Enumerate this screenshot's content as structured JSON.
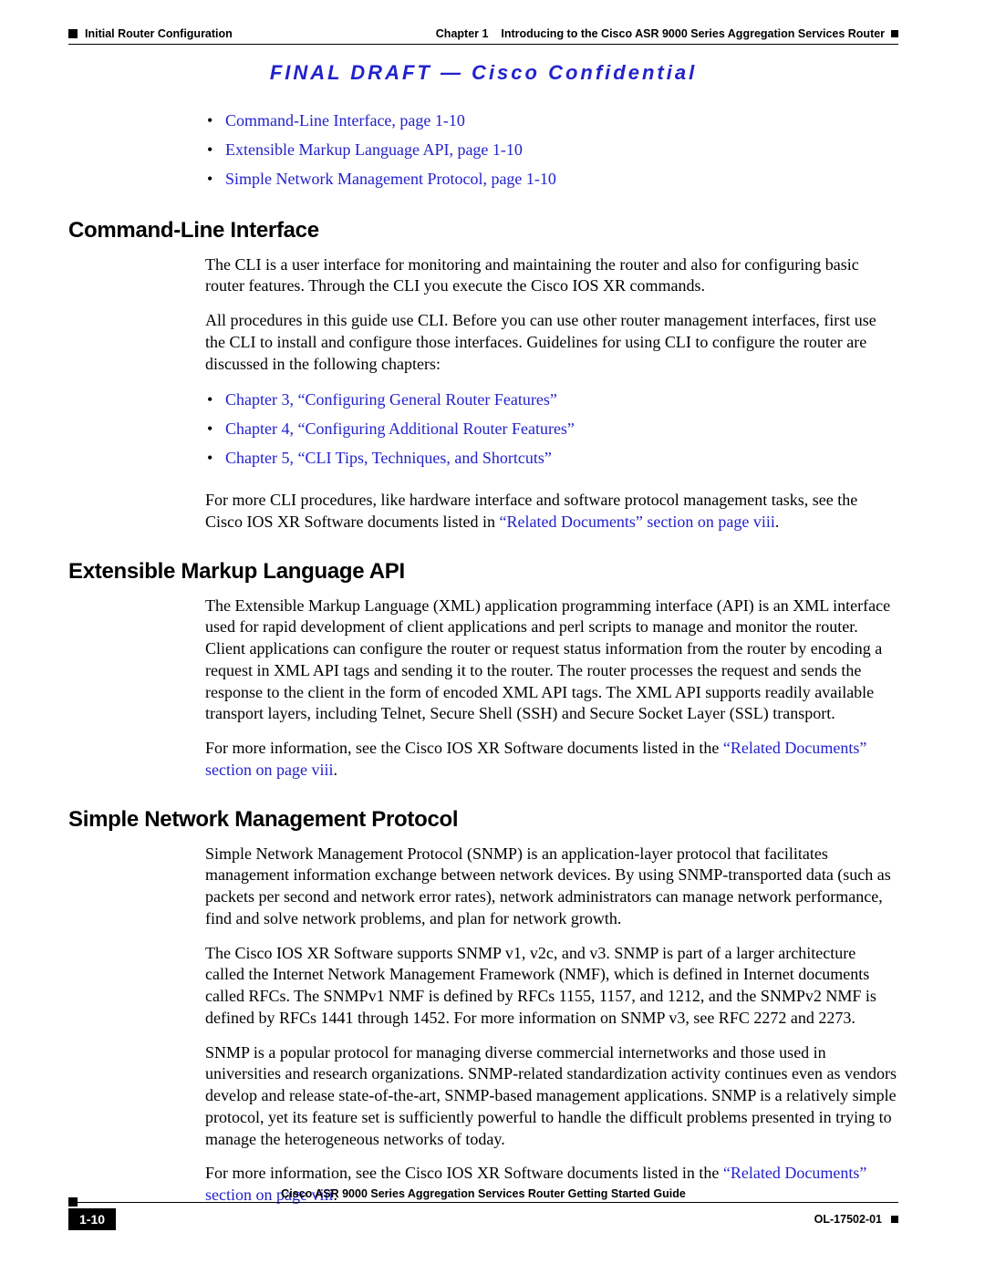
{
  "header": {
    "left": "Initial Router Configuration",
    "right_prefix": "Chapter 1",
    "right_title": "Introducing to the Cisco ASR 9000 Series Aggregation Services Router"
  },
  "banner": "FINAL DRAFT — Cisco Confidential",
  "top_links": [
    "Command-Line Interface, page 1-10",
    "Extensible Markup Language API, page 1-10",
    "Simple Network Management Protocol, page 1-10"
  ],
  "sections": {
    "cli": {
      "heading": "Command-Line Interface",
      "p1": "The CLI is a user interface for monitoring and maintaining the router and also for configuring basic router features. Through the CLI you execute the Cisco IOS XR commands.",
      "p2": "All procedures in this guide use CLI. Before you can use other router management interfaces, first use the CLI to install and configure those interfaces. Guidelines for using CLI to configure the router are discussed in the following chapters:",
      "bullets": [
        "Chapter 3, “Configuring General Router Features”",
        "Chapter 4, “Configuring Additional Router Features”",
        "Chapter 5, “CLI Tips, Techniques, and Shortcuts”"
      ],
      "p3a": "For more CLI procedures, like hardware interface and software protocol management tasks, see the Cisco IOS XR Software documents listed in ",
      "p3_link": "“Related Documents” section on page viii",
      "p3b": "."
    },
    "xml": {
      "heading": "Extensible Markup Language API",
      "p1": "The Extensible Markup Language (XML) application programming interface (API) is an XML interface used for rapid development of client applications and perl scripts to manage and monitor the router. Client applications can configure the router or request status information from the router by encoding a request in XML API tags and sending it to the router. The router processes the request and sends the response to the client in the form of encoded XML API tags. The XML API supports readily available transport layers, including Telnet, Secure Shell (SSH) and Secure Socket Layer (SSL) transport.",
      "p2a": "For more information, see the Cisco IOS XR Software documents listed in the ",
      "p2_link": "“Related Documents” section on page viii",
      "p2b": "."
    },
    "snmp": {
      "heading": "Simple Network Management Protocol",
      "p1": "Simple Network Management Protocol (SNMP) is an application-layer protocol that facilitates management information exchange between network devices. By using SNMP-transported data (such as packets per second and network error rates), network administrators can manage network performance, find and solve network problems, and plan for network growth.",
      "p2": "The Cisco IOS XR Software supports SNMP v1, v2c, and v3. SNMP is part of a larger architecture called the Internet Network Management Framework (NMF), which is defined in Internet documents called RFCs. The SNMPv1 NMF is defined by RFCs 1155, 1157, and 1212, and the SNMPv2 NMF is defined by RFCs 1441 through 1452. For more information on SNMP v3, see RFC 2272 and 2273.",
      "p3": "SNMP is a popular protocol for managing diverse commercial internetworks and those used in universities and research organizations. SNMP-related standardization activity continues even as vendors develop and release state-of-the-art, SNMP-based management applications. SNMP is a relatively simple protocol, yet its feature set is sufficiently powerful to handle the difficult problems presented in trying to manage the heterogeneous networks of today.",
      "p4a": "For more information, see the Cisco IOS XR Software documents listed in the ",
      "p4_link": "“Related Documents” section on page viii",
      "p4b": "."
    }
  },
  "footer": {
    "title": "Cisco ASR 9000 Series Aggregation Services Router Getting Started Guide",
    "page": "1-10",
    "docnum": "OL-17502-01"
  }
}
